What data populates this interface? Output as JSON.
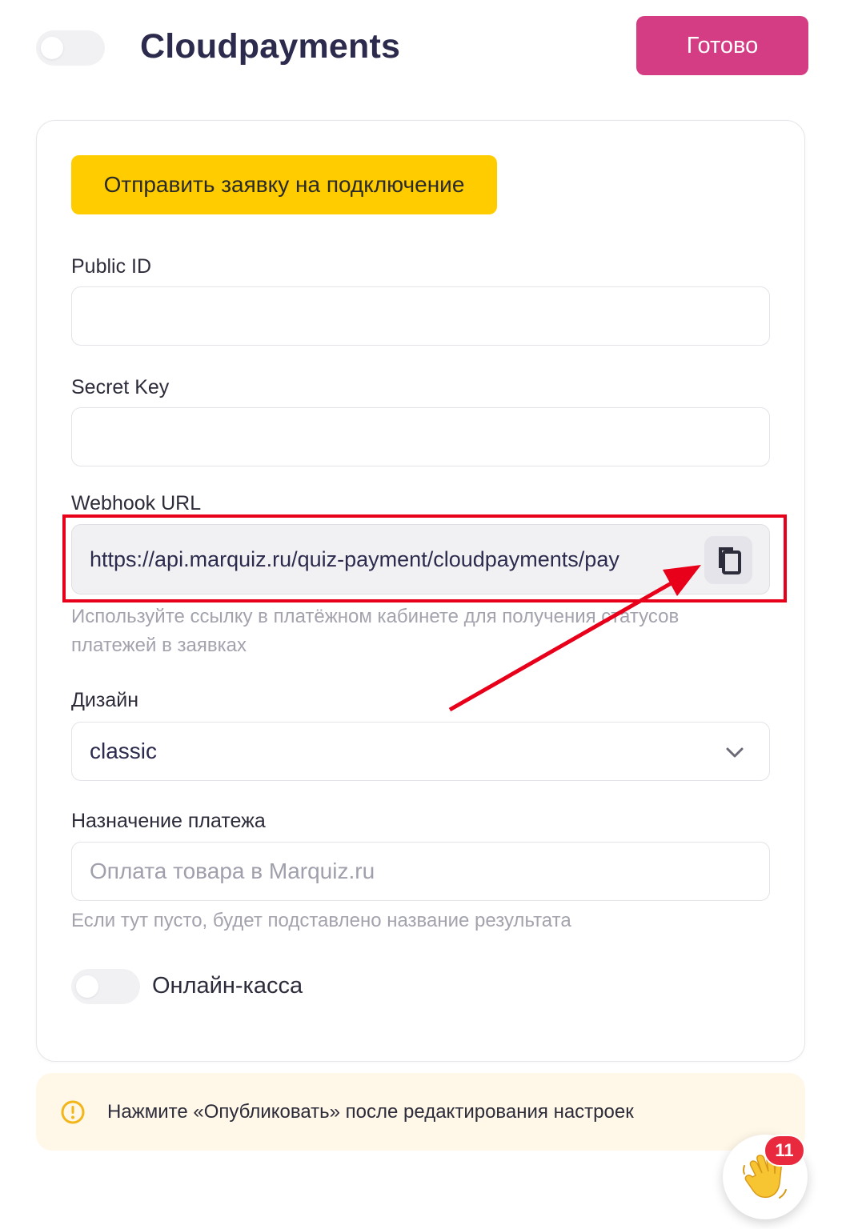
{
  "header": {
    "title": "Cloudpayments",
    "done_label": "Готово"
  },
  "card": {
    "connect_button": "Отправить заявку на подключение",
    "public_id": {
      "label": "Public ID",
      "value": ""
    },
    "secret_key": {
      "label": "Secret Key",
      "value": ""
    },
    "webhook": {
      "label": "Webhook URL",
      "value": "https://api.marquiz.ru/quiz-payment/cloudpayments/pay",
      "hint_line1": "Используйте ссылку в платёжном кабинете для получения статусов",
      "hint_line2": "платежей в заявках"
    },
    "design": {
      "label": "Дизайн",
      "selected": "classic"
    },
    "purpose": {
      "label": "Назначение платежа",
      "placeholder": "Оплата товара в Marquiz.ru",
      "hint": "Если тут пусто, будет подставлено название результата"
    },
    "online_kassa": {
      "label": "Онлайн-касса",
      "enabled": false
    }
  },
  "notice": {
    "text": "Нажмите «Опубликовать» после редактирования настроек"
  },
  "chat": {
    "badge_count": "11",
    "icon": "waving-hand-icon"
  },
  "colors": {
    "accent": "#d43d84",
    "yellow": "#ffcc00",
    "highlight": "#e8001b",
    "badge": "#e9293e"
  }
}
